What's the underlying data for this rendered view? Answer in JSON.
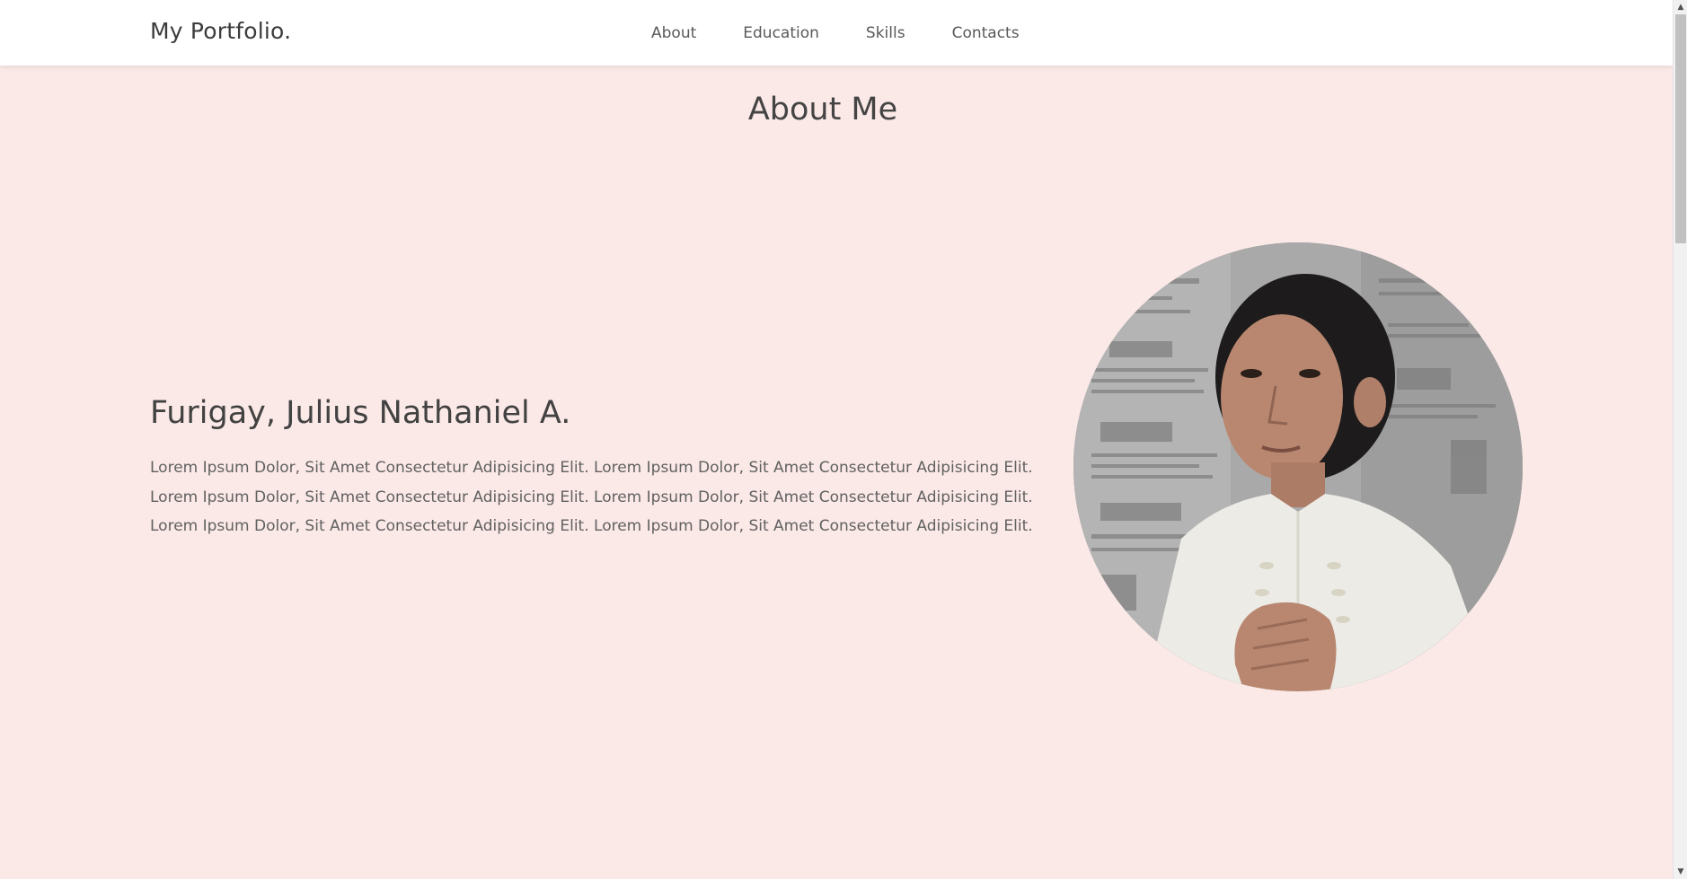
{
  "header": {
    "logo": "My Portfolio.",
    "nav": [
      {
        "label": "About"
      },
      {
        "label": "Education"
      },
      {
        "label": "Skills"
      },
      {
        "label": "Contacts"
      }
    ]
  },
  "about": {
    "section_title": "About Me",
    "name": "Furigay, Julius Nathaniel A.",
    "description": "Lorem Ipsum Dolor, Sit Amet Consectetur Adipisicing Elit. Lorem Ipsum Dolor, Sit Amet Consectetur Adipisicing Elit. Lorem Ipsum Dolor, Sit Amet Consectetur Adipisicing Elit. Lorem Ipsum Dolor, Sit Amet Consectetur Adipisicing Elit. Lorem Ipsum Dolor, Sit Amet Consectetur Adipisicing Elit. Lorem Ipsum Dolor, Sit Amet Consectetur Adipisicing Elit."
  },
  "colors": {
    "page_background": "#fbe9e7",
    "header_background": "#ffffff",
    "heading_text": "#444444",
    "body_text": "#616161"
  },
  "icons": {
    "scroll_up": "chevron-up-icon",
    "scroll_down": "chevron-down-icon"
  }
}
